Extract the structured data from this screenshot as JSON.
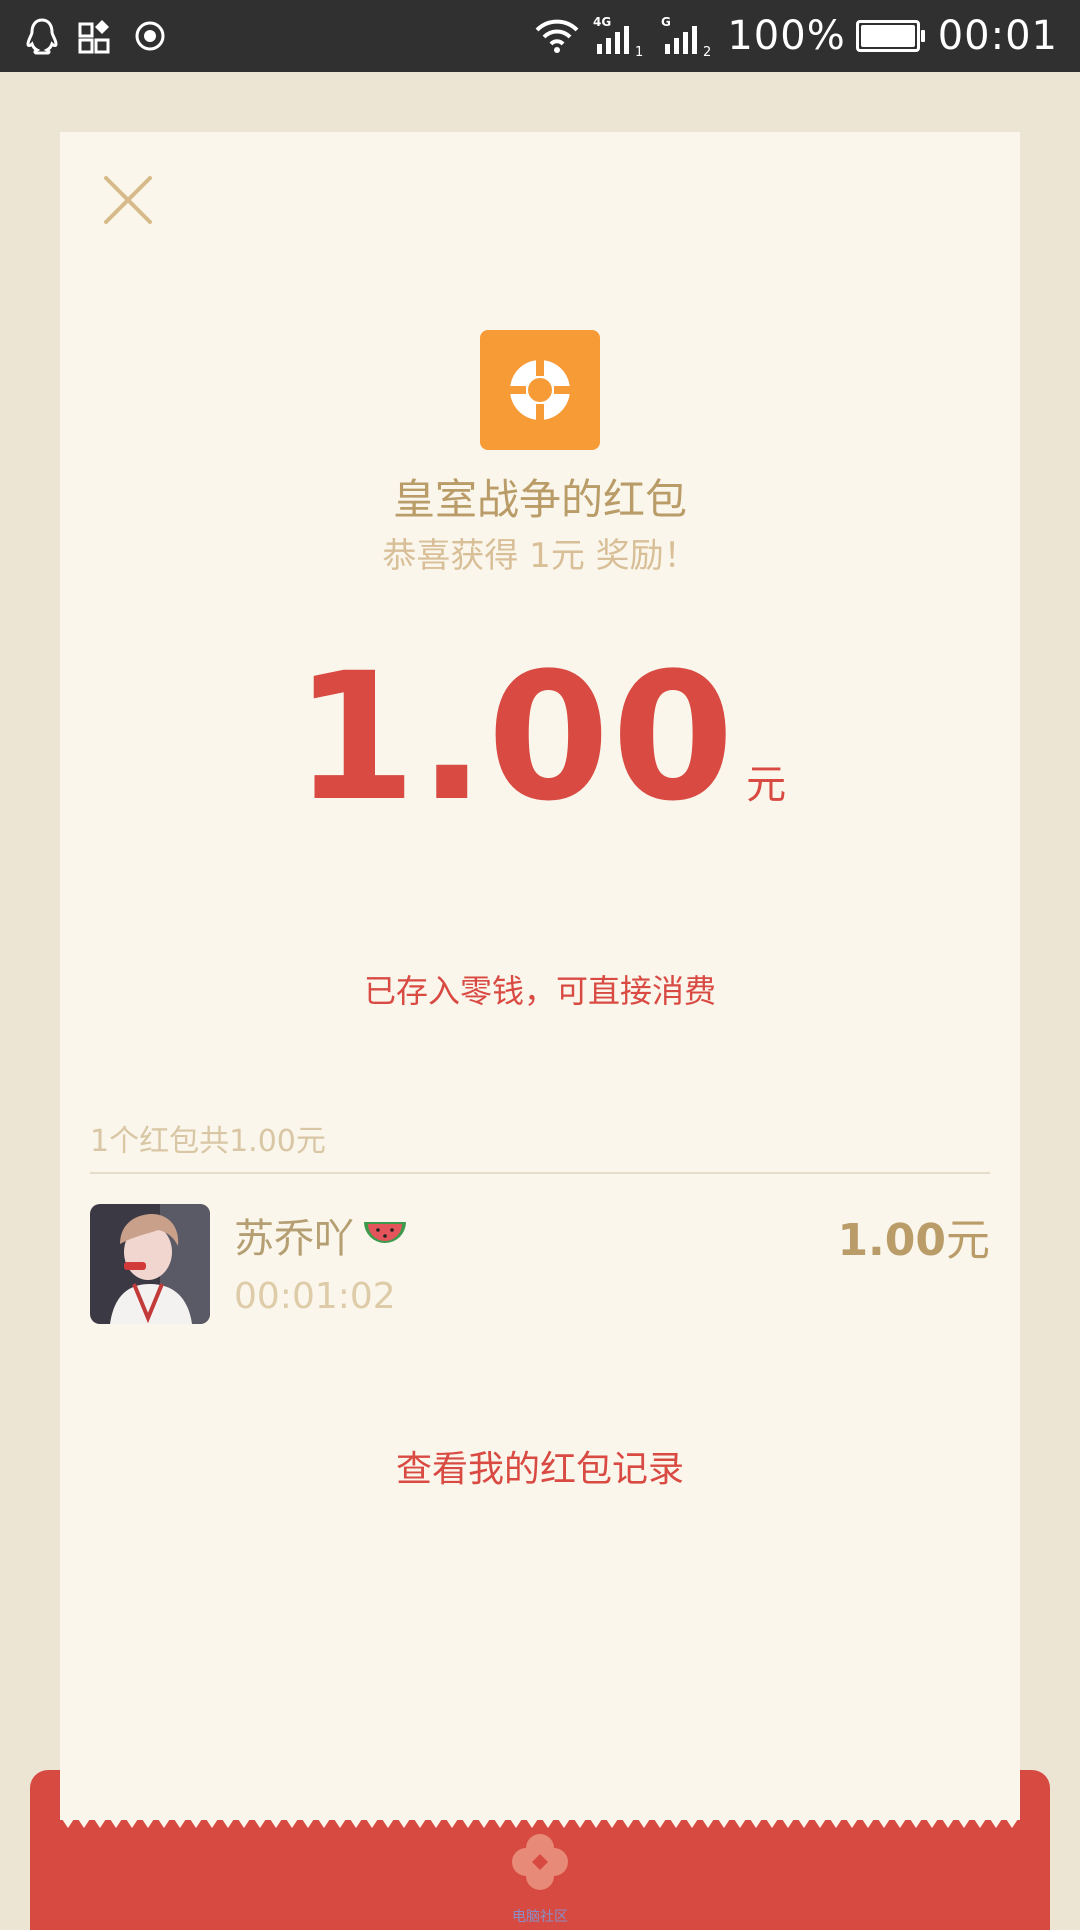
{
  "status_bar": {
    "left_icons": [
      "penguin-icon",
      "apps-icon",
      "record-icon"
    ],
    "right_icons": [
      "wifi-icon",
      "signal-4g-icon",
      "signal-g-icon",
      "battery-icon"
    ],
    "network_1_label": "4G",
    "network_2_label": "G",
    "sim_1": "1",
    "sim_2": "2",
    "battery": "100%",
    "battery_level": 1.0,
    "time": "00:01"
  },
  "card": {
    "close_icon": "close-icon",
    "app_icon": "game-logo-icon",
    "app_icon_color": "#f79b37",
    "title": "皇室战争的红包",
    "subtitle": "恭喜获得 1元 奖励！",
    "amount": "1.00",
    "amount_unit": "元",
    "amount_note": "已存入零钱，可直接消费",
    "summary": "1个红包共1.00元",
    "entry": {
      "name": "苏乔吖",
      "name_emoji": "watermelon-icon",
      "time": "00:01:02",
      "amount": "1.00",
      "amount_unit": "元"
    },
    "records_link": "查看我的红包记录"
  },
  "envelope": {
    "logo_icon": "flower-logo-icon",
    "caption": "电脑社区",
    "color": "#d74a41"
  },
  "colors": {
    "background": "#ece5d4",
    "card": "#faf6ec",
    "accent_red": "#d84a42",
    "gold_text": "#b99c67"
  }
}
